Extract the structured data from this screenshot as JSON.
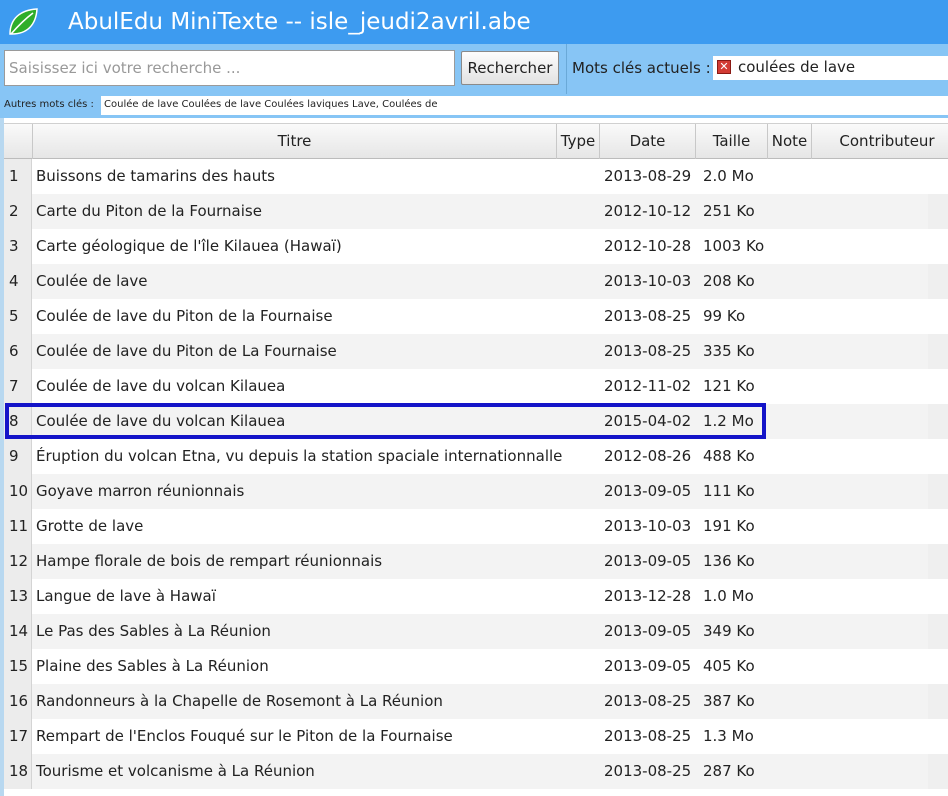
{
  "window": {
    "title": "AbulEdu MiniTexte -- isle_jeudi2avril.abe",
    "logo_icon": "leaf-icon"
  },
  "search": {
    "placeholder": "Saisissez ici votre recherche ...",
    "button_label": "Rechercher",
    "current_keywords_label": "Mots clés actuels :",
    "current_keyword": "coulées de lave",
    "remove_icon": "close-icon"
  },
  "other_keywords": {
    "label": "Autres mots clés :",
    "value": "Coulée de lave  Coulées de lave  Coulées laviques  Lave, Coulées de"
  },
  "table": {
    "columns": [
      "Titre",
      "Type",
      "Date",
      "Taille",
      "Note",
      "Contributeur"
    ],
    "rows": [
      {
        "n": "1",
        "titre": "Buissons de tamarins des hauts",
        "date": "2013-08-29",
        "taille": "2.0 Mo"
      },
      {
        "n": "2",
        "titre": "Carte du Piton de la Fournaise",
        "date": "2012-10-12",
        "taille": "251 Ko"
      },
      {
        "n": "3",
        "titre": "Carte géologique de l'île Kilauea (Hawaï)",
        "date": "2012-10-28",
        "taille": "1003 Ko"
      },
      {
        "n": "4",
        "titre": "Coulée de lave",
        "date": "2013-10-03",
        "taille": "208 Ko"
      },
      {
        "n": "5",
        "titre": "Coulée de lave du Piton de la Fournaise",
        "date": "2013-08-25",
        "taille": "99 Ko"
      },
      {
        "n": "6",
        "titre": "Coulée de lave du Piton de La Fournaise",
        "date": "2013-08-25",
        "taille": "335 Ko"
      },
      {
        "n": "7",
        "titre": "Coulée de lave du volcan Kilauea",
        "date": "2012-11-02",
        "taille": "121 Ko"
      },
      {
        "n": "8",
        "titre": "Coulée de lave du volcan Kilauea",
        "date": "2015-04-02",
        "taille": "1.2 Mo"
      },
      {
        "n": "9",
        "titre": "Éruption du volcan Etna, vu depuis la station spaciale internationnalle",
        "date": "2012-08-26",
        "taille": "488 Ko"
      },
      {
        "n": "10",
        "titre": "Goyave marron réunionnais",
        "date": "2013-09-05",
        "taille": "111 Ko"
      },
      {
        "n": "11",
        "titre": "Grotte de lave",
        "date": "2013-10-03",
        "taille": "191 Ko"
      },
      {
        "n": "12",
        "titre": "Hampe florale de bois de rempart réunionnais",
        "date": "2013-09-05",
        "taille": "136 Ko"
      },
      {
        "n": "13",
        "titre": "Langue de lave à Hawaï",
        "date": "2013-12-28",
        "taille": "1.0 Mo"
      },
      {
        "n": "14",
        "titre": "Le Pas des Sables à La Réunion",
        "date": "2013-09-05",
        "taille": "349 Ko"
      },
      {
        "n": "15",
        "titre": "Plaine des Sables à La Réunion",
        "date": "2013-09-05",
        "taille": "405 Ko"
      },
      {
        "n": "16",
        "titre": "Randonneurs à la Chapelle de Rosemont à La Réunion",
        "date": "2013-08-25",
        "taille": "387 Ko"
      },
      {
        "n": "17",
        "titre": "Rempart de l'Enclos Fouqué sur le Piton de la Fournaise",
        "date": "2013-08-25",
        "taille": "1.3 Mo"
      },
      {
        "n": "18",
        "titre": "Tourisme et volcanisme à La Réunion",
        "date": "2013-08-25",
        "taille": "287 Ko"
      }
    ],
    "selected_row": 8,
    "highlight_color": "#1414c8"
  }
}
